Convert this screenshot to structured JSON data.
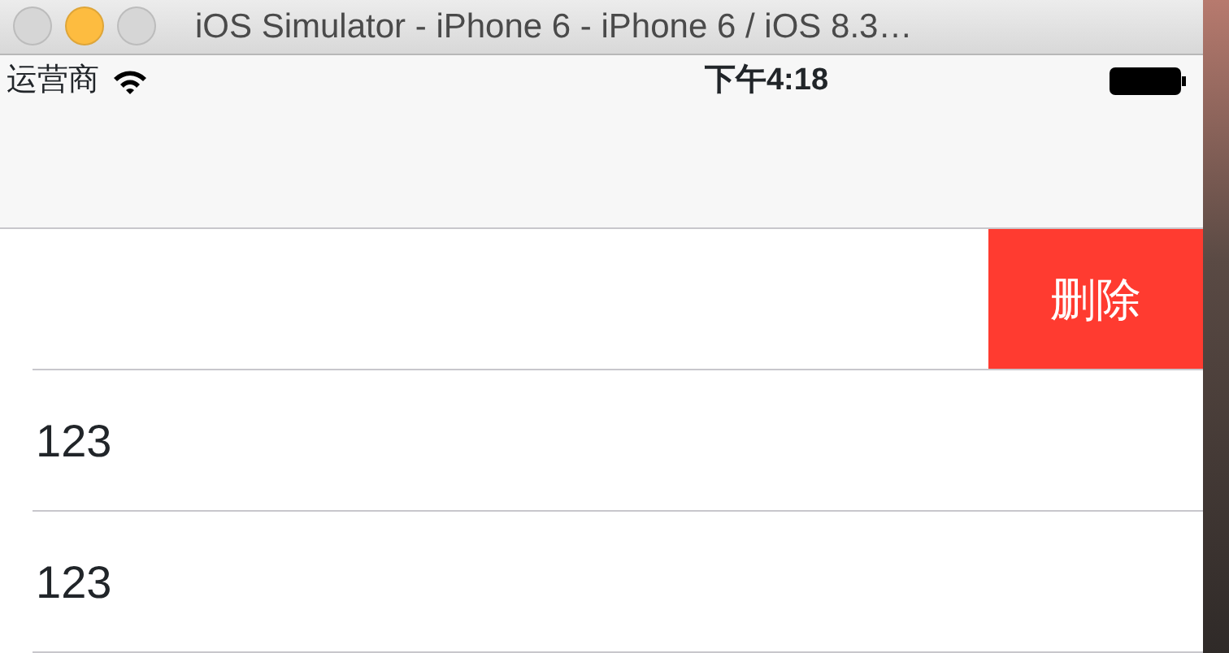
{
  "window": {
    "title": "iOS Simulator - iPhone 6 - iPhone 6 / iOS 8.3…",
    "buttons": [
      {
        "color": "#d6d6d6"
      },
      {
        "color": "#fdbc40"
      },
      {
        "color": "#d6d6d6"
      }
    ]
  },
  "status_bar": {
    "carrier": "运营商",
    "time": "下午4:18"
  },
  "table": {
    "rows": [
      {
        "swiped": true,
        "action": "删除"
      },
      {
        "swiped": false,
        "label": "123"
      },
      {
        "swiped": false,
        "label": "123"
      }
    ]
  }
}
